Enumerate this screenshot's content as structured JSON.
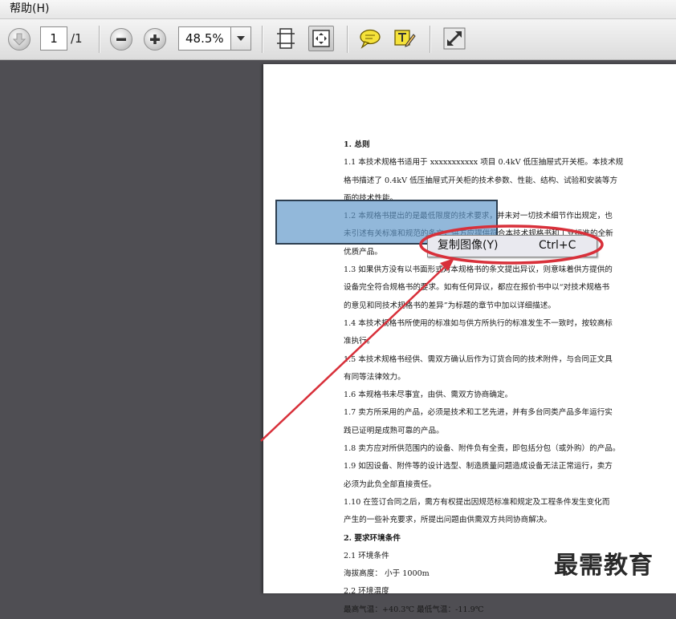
{
  "menubar": {
    "help": "帮助(H)"
  },
  "toolbar": {
    "page_current": "1",
    "page_total": "/1",
    "zoom": "48.5%"
  },
  "document": {
    "lines": [
      {
        "text": "1. 总则",
        "head": true
      },
      {
        "text": "1.1 本技术规格书适用于 xxxxxxxxxxx 项目 0.4kV 低压抽屉式开关柜。本技术规",
        "head": false
      },
      {
        "text": "格书描述了 0.4kV 低压抽屉式开关柜的技术参数、性能、结构、试验和安装等方",
        "head": false
      },
      {
        "text": "面的技术性能。",
        "head": false
      },
      {
        "text": "1.2 本规格书提出的是最低限度的技术要求，并未对一切技术细节作出规定，也",
        "head": false
      },
      {
        "text": "未引述有关标准和规范的条文，供方应提供符合本技术规格书和工业标准的全新",
        "head": false
      },
      {
        "text": "优质产品。",
        "head": false
      },
      {
        "text": "1.3 如果供方没有以书面形式对本规格书的条文提出异议，则意味着供方提供的",
        "head": false
      },
      {
        "text": "设备完全符合规格书的要求。如有任何异议，都应在报价书中以“对技术规格书",
        "head": false
      },
      {
        "text": "的意见和同技术规格书的差异”为标题的章节中加以详细描述。",
        "head": false
      },
      {
        "text": "1.4 本技术规格书所使用的标准如与供方所执行的标准发生不一致时，按较高标",
        "head": false
      },
      {
        "text": "准执行。",
        "head": false
      },
      {
        "text": "1.5 本技术规格书经供、需双方确认后作为订货合同的技术附件，与合同正文具",
        "head": false
      },
      {
        "text": "有同等法律效力。",
        "head": false
      },
      {
        "text": "1.6 本规格书未尽事宜，由供、需双方协商确定。",
        "head": false
      },
      {
        "text": "1.7 卖方所采用的产品，必须是技术和工艺先进，并有多台同类产品多年运行实",
        "head": false
      },
      {
        "text": "践已证明是成熟可靠的产品。",
        "head": false
      },
      {
        "text": "1.8 卖方应对所供范围内的设备、附件负有全责，即包括分包（或外购）的产品。",
        "head": false
      },
      {
        "text": "1.9 如因设备、附件等的设计选型、制造质量问题造成设备无法正常运行，卖方",
        "head": false
      },
      {
        "text": "必须为此负全部直接责任。",
        "head": false
      },
      {
        "text": "1.10 在签订合同之后，需方有权提出因规范标准和规定及工程条件发生变化而",
        "head": false
      },
      {
        "text": "产生的一些补充要求，所提出问题由供需双方共同协商解决。",
        "head": false
      },
      {
        "text": "2. 要求环境条件",
        "head": true
      },
      {
        "text": "2.1 环境条件",
        "head": false
      },
      {
        "text": "      海拔高度：        小于 1000m",
        "head": false
      },
      {
        "text": "2.2 环境温度",
        "head": false
      },
      {
        "text": "      最高气温：+40.3℃                              最低气温：-11.9℃",
        "head": false
      }
    ]
  },
  "context_menu": {
    "copy_image_label": "复制图像(Y)",
    "copy_image_shortcut": "Ctrl+C"
  },
  "annotation": {
    "ellipse_color": "#d8303a",
    "arrow_color": "#d8303a"
  },
  "watermark": "最需教育"
}
